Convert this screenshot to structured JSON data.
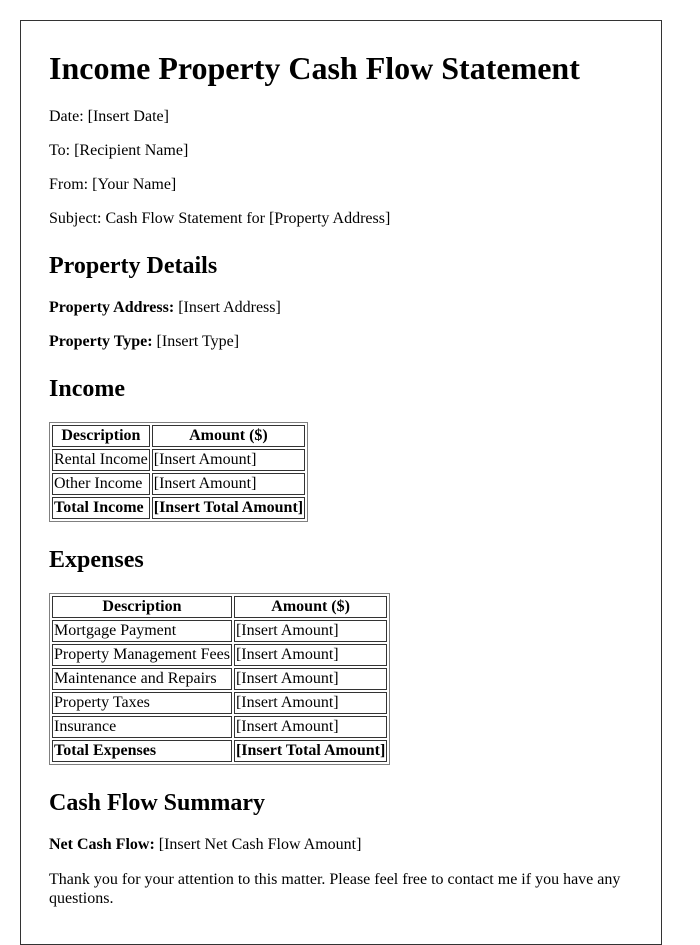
{
  "document": {
    "title": "Income Property Cash Flow Statement",
    "header_lines": [
      {
        "label": "Date:",
        "value": "[Insert Date]"
      },
      {
        "label": "To:",
        "value": "[Recipient Name]"
      },
      {
        "label": "From:",
        "value": "[Your Name]"
      },
      {
        "label": "Subject:",
        "value": "Cash Flow Statement for [Property Address]"
      }
    ],
    "header_text": [
      "Date: [Insert Date]",
      "To: [Recipient Name]",
      "From: [Your Name]",
      "Subject: Cash Flow Statement for [Property Address]"
    ]
  },
  "property_details": {
    "heading": "Property Details",
    "address_label": "Property Address:",
    "address_value": " [Insert Address]",
    "type_label": "Property Type:",
    "type_value": " [Insert Type]"
  },
  "income": {
    "heading": "Income",
    "columns": [
      "Description",
      "Amount ($)"
    ],
    "rows": [
      [
        "Rental Income",
        "[Insert Amount]"
      ],
      [
        "Other Income",
        "[Insert Amount]"
      ]
    ],
    "total": [
      "Total Income",
      "[Insert Total Amount]"
    ]
  },
  "expenses": {
    "heading": "Expenses",
    "columns": [
      "Description",
      "Amount ($)"
    ],
    "rows": [
      [
        "Mortgage Payment",
        "[Insert Amount]"
      ],
      [
        "Property Management Fees",
        "[Insert Amount]"
      ],
      [
        "Maintenance and Repairs",
        "[Insert Amount]"
      ],
      [
        "Property Taxes",
        "[Insert Amount]"
      ],
      [
        "Insurance",
        "[Insert Amount]"
      ]
    ],
    "total": [
      "Total Expenses",
      "[Insert Total Amount]"
    ]
  },
  "summary": {
    "heading": "Cash Flow Summary",
    "net_label": "Net Cash Flow:",
    "net_value": " [Insert Net Cash Flow Amount]",
    "closing": "Thank you for your attention to this matter. Please feel free to contact me if you have any questions."
  }
}
